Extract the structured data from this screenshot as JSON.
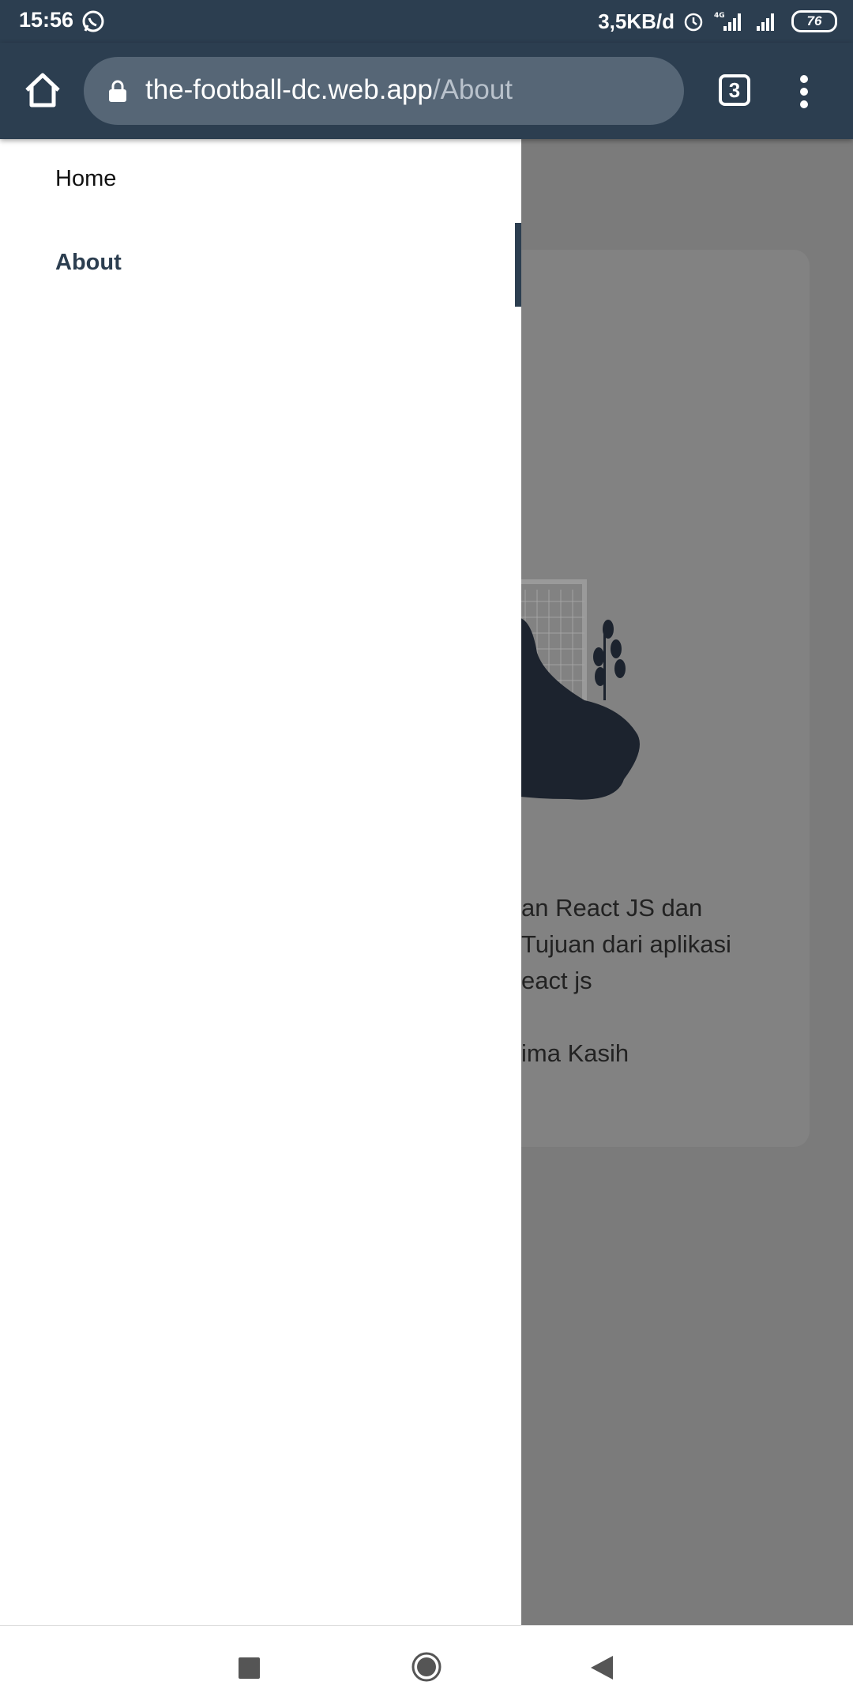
{
  "status": {
    "time": "15:56",
    "speed": "3,5KB/d",
    "network_label": "4G",
    "battery": "76"
  },
  "browser": {
    "url_host": "the-football-dc.web.app",
    "url_path": "/About",
    "tab_count": "3"
  },
  "drawer": {
    "items": [
      {
        "label": "Home"
      },
      {
        "label": "About"
      }
    ],
    "active_index": 1
  },
  "about": {
    "text_lines": [
      "an React JS dan",
      "Tujuan dari aplikasi",
      "eact js",
      "ima Kasih"
    ]
  },
  "colors": {
    "primary": "#2c3e50",
    "overlay": "#7b7b7b"
  }
}
